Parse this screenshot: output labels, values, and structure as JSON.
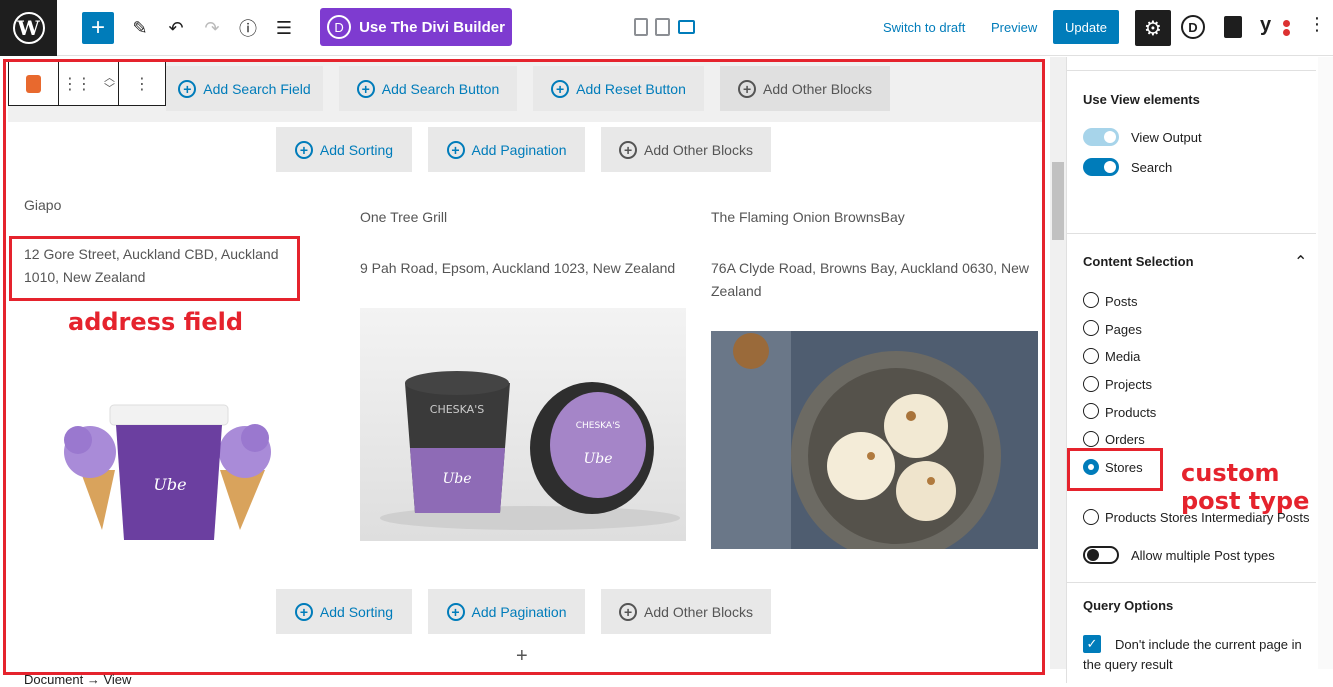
{
  "topbar": {
    "logo_letter": "W",
    "add_block": "+",
    "tools": [
      "pencil-icon",
      "undo-icon",
      "redo-icon",
      "info-icon",
      "list-view-icon"
    ],
    "divi_button": "Use The Divi Builder",
    "divi_letter": "D",
    "switch_to_draft": "Switch to draft",
    "preview": "Preview",
    "update": "Update",
    "settings_icon": "⚙",
    "d_icon_letter": "D",
    "yoast_letter": "y",
    "more": "⋮"
  },
  "editor": {
    "search_buttons": [
      "Add Search Field",
      "Add Search Button",
      "Add Reset Button",
      "Add Other Blocks"
    ],
    "top_buttons": [
      "Add Sorting",
      "Add Pagination",
      "Add Other Blocks"
    ],
    "bottom_buttons": [
      "Add Sorting",
      "Add Pagination",
      "Add Other Blocks"
    ],
    "stores": [
      {
        "title": "Giapo",
        "address_line1": "12 Gore Street, Auckland CBD, Auckland",
        "address_line2": "1010, New Zealand"
      },
      {
        "title": "One Tree Grill",
        "address_line1": "9 Pah Road, Epsom, Auckland 1023, New Zealand",
        "address_line2": ""
      },
      {
        "title": "The Flaming Onion BrownsBay",
        "address_line1": "76A Clyde Road, Browns Bay, Auckland 0630, New",
        "address_line2": "Zealand"
      }
    ],
    "annotation_address": "address field",
    "add_icon": "+",
    "breadcrumb": "Document → View"
  },
  "sidebar": {
    "use_view_elements": "Use View elements",
    "view_output": "View Output",
    "search": "Search",
    "content_selection": "Content Selection",
    "post_types": [
      "Posts",
      "Pages",
      "Media",
      "Projects",
      "Products",
      "Orders",
      "Stores",
      "Products Stores Intermediary Posts"
    ],
    "allow_multiple": "Allow multiple Post types",
    "query_options": "Query Options",
    "exclude_current_1": "Don't include the current page in",
    "exclude_current_2": "the query result",
    "annotation_custom_1": "custom",
    "annotation_custom_2": "post type",
    "collapse_icon": "⌃"
  },
  "colors": {
    "accent": "#007cba",
    "divi": "#7e3bd0",
    "annotation_red": "#e5232d"
  }
}
